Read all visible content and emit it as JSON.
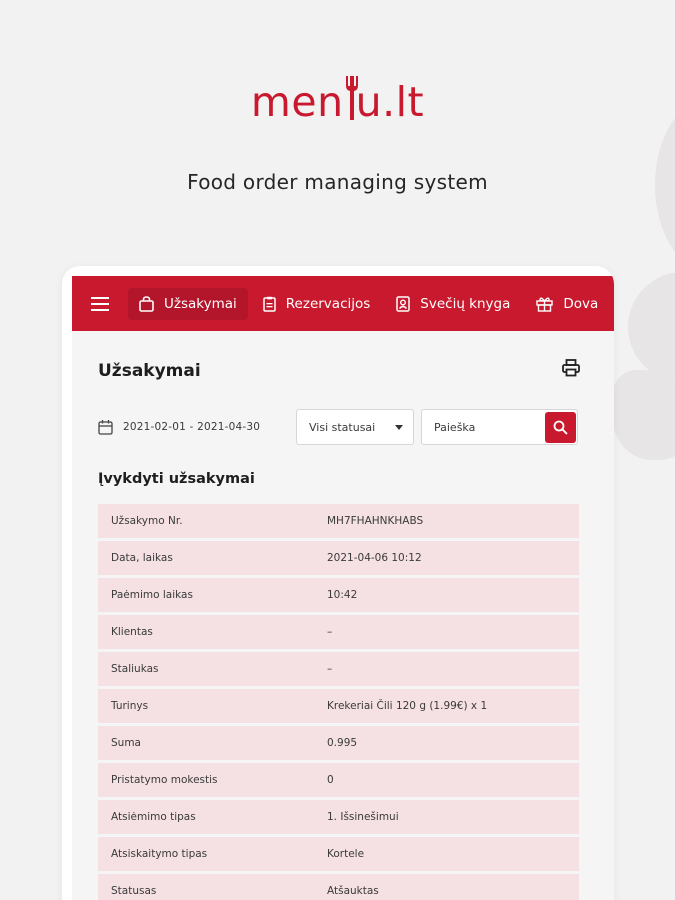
{
  "logo": {
    "text_before": "men",
    "text_after": "u.lt"
  },
  "tagline": "Food order managing system",
  "navbar": {
    "items": [
      {
        "label": "Užsakymai",
        "icon": "shopping-bag-icon",
        "active": true
      },
      {
        "label": "Rezervacijos",
        "icon": "clipboard-icon",
        "active": false
      },
      {
        "label": "Svečių knyga",
        "icon": "guest-book-icon",
        "active": false
      },
      {
        "label": "Dova",
        "icon": "gift-icon",
        "active": false
      }
    ]
  },
  "page_title": "Užsakymai",
  "filters": {
    "date_range": "2021-02-01 - 2021-04-30",
    "status_selected": "Visi statusai",
    "search_placeholder": "Paieška"
  },
  "section_title": "Įvykdyti užsakymai",
  "details": [
    {
      "label": "Užsakymo Nr.",
      "value": "MH7FHAHNKHABS"
    },
    {
      "label": "Data, laikas",
      "value": "2021-04-06 10:12"
    },
    {
      "label": "Paėmimo laikas",
      "value": "10:42"
    },
    {
      "label": "Klientas",
      "value": "–"
    },
    {
      "label": "Staliukas",
      "value": "–"
    },
    {
      "label": "Turinys",
      "value": "Krekeriai Čili 120 g (1.99€) x 1"
    },
    {
      "label": "Suma",
      "value": "0.995"
    },
    {
      "label": "Pristatymo mokestis",
      "value": "0"
    },
    {
      "label": "Atsiėmimo tipas",
      "value": "1. Išsinešimui"
    },
    {
      "label": "Atsiskaitymo tipas",
      "value": "Kortele"
    },
    {
      "label": "Statusas",
      "value": "Atšauktas"
    }
  ],
  "colors": {
    "brand": "#c8192e",
    "row_bg": "#f5e1e3",
    "page_bg": "#f3f2f2"
  }
}
